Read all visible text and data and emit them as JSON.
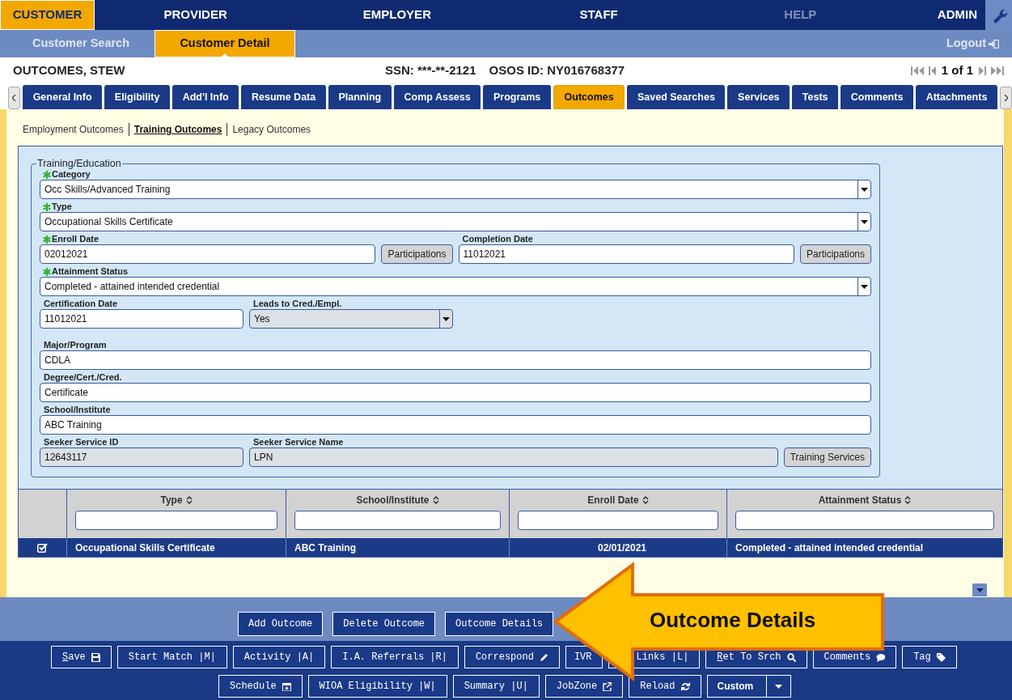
{
  "top_nav": [
    {
      "label": "CUSTOMER",
      "selected": true,
      "disabled": false
    },
    {
      "label": "PROVIDER",
      "selected": false,
      "disabled": false
    },
    {
      "label": "EMPLOYER",
      "selected": false,
      "disabled": false
    },
    {
      "label": "STAFF",
      "selected": false,
      "disabled": false
    },
    {
      "label": "HELP",
      "selected": false,
      "disabled": true
    },
    {
      "label": "ADMIN",
      "selected": false,
      "disabled": false
    }
  ],
  "sub_nav": [
    {
      "label": "Customer Search",
      "selected": false
    },
    {
      "label": "Customer Detail",
      "selected": true
    }
  ],
  "logout": "Logout",
  "record": {
    "name": "OUTCOMES, STEW",
    "ssn": "SSN: ***-**-2121",
    "osos_id": "OSOS ID: NY016768377",
    "pager": "1 of 1"
  },
  "tabs": [
    {
      "label": "General Info",
      "selected": false
    },
    {
      "label": "Eligibility",
      "selected": false
    },
    {
      "label": "Add'l Info",
      "selected": false
    },
    {
      "label": "Resume Data",
      "selected": false
    },
    {
      "label": "Planning",
      "selected": false
    },
    {
      "label": "Comp Assess",
      "selected": false
    },
    {
      "label": "Programs",
      "selected": false
    },
    {
      "label": "Outcomes",
      "selected": true
    },
    {
      "label": "Saved Searches",
      "selected": false
    },
    {
      "label": "Services",
      "selected": false
    },
    {
      "label": "Tests",
      "selected": false
    },
    {
      "label": "Comments",
      "selected": false
    },
    {
      "label": "Attachments",
      "selected": false
    }
  ],
  "subtabs": [
    {
      "label": "Employment Outcomes",
      "selected": false
    },
    {
      "label": "Training Outcomes",
      "selected": true
    },
    {
      "label": "Legacy Outcomes",
      "selected": false
    }
  ],
  "form": {
    "legend": "Training/Education",
    "rows": [
      [
        {
          "label": "Category",
          "required": true,
          "kind": "select",
          "value": "Occ Skills/Advanced Training"
        }
      ],
      [
        {
          "label": "Type",
          "required": true,
          "kind": "select",
          "value": "Occupational Skills Certificate"
        }
      ],
      [
        {
          "label": "Enroll Date",
          "required": true,
          "kind": "text",
          "value": "02012021",
          "button": "Participations"
        },
        {
          "label": "Completion Date",
          "required": false,
          "kind": "text",
          "value": "11012021",
          "button": "Participations"
        }
      ],
      [
        {
          "label": "Attainment Status",
          "required": true,
          "kind": "select",
          "value": "Completed - attained intended credential"
        }
      ],
      [
        {
          "label": "Certification Date",
          "required": false,
          "kind": "text",
          "value": "11012021"
        },
        {
          "label": "Leads to Cred./Empl.",
          "required": false,
          "kind": "locked-select",
          "value": "Yes"
        }
      ],
      [
        {
          "label": "Major/Program",
          "required": false,
          "kind": "text",
          "value": "CDLA"
        }
      ],
      [
        {
          "label": "Degree/Cert./Cred.",
          "required": false,
          "kind": "text",
          "value": "Certificate"
        }
      ],
      [
        {
          "label": "School/Institute",
          "required": false,
          "kind": "text",
          "value": "ABC Training"
        }
      ],
      [
        {
          "label": "Seeker Service ID",
          "required": false,
          "kind": "readonly",
          "value": "12643117"
        },
        {
          "label": "Seeker Service Name",
          "required": false,
          "kind": "readonly",
          "value": "LPN",
          "button": "Training Services"
        }
      ]
    ]
  },
  "grid": {
    "columns": [
      "Type",
      "School/Institute",
      "Enroll Date",
      "Attainment Status"
    ],
    "rows": [
      {
        "checked": true,
        "selected": true,
        "cells": [
          "Occupational Skills Certificate",
          "ABC Training",
          "02/01/2021",
          "Completed - attained intended credential"
        ]
      }
    ]
  },
  "actions": [
    "Add Outcome",
    "Delete Outcome",
    "Outcome Details"
  ],
  "toolbar": [
    [
      {
        "label": "Save",
        "kind": "save",
        "underline_first": true
      },
      {
        "label": "Start Match |M|",
        "kind": "plain",
        "underline_first": false
      },
      {
        "label": "Activity |A|",
        "kind": "plain",
        "underline_first": false
      },
      {
        "label": "I.A. Referrals |R|",
        "kind": "plain",
        "underline_first": false
      },
      {
        "label": "Correspond",
        "kind": "pencil",
        "underline_first": false
      },
      {
        "label": "IVR",
        "kind": "plain",
        "underline_first": false
      },
      {
        "label": "Links |L|",
        "kind": "plain",
        "underline_first": false
      },
      {
        "label": "Ret To Srch",
        "kind": "search",
        "underline_first": true
      },
      {
        "label": "Comments",
        "kind": "comment",
        "underline_first": false
      },
      {
        "label": "Tag",
        "kind": "tag",
        "underline_first": false
      }
    ],
    [
      {
        "label": "Schedule",
        "kind": "calendar",
        "underline_first": false
      },
      {
        "label": "WIOA Eligibility |W|",
        "kind": "plain",
        "underline_first": false
      },
      {
        "label": "Summary |U|",
        "kind": "plain",
        "underline_first": false
      },
      {
        "label": "JobZone",
        "kind": "external",
        "underline_first": false
      },
      {
        "label": "Reload",
        "kind": "reload",
        "underline_first": false
      },
      {
        "label": "Custom",
        "kind": "split",
        "underline_first": false
      }
    ]
  ],
  "callout": {
    "text": "Outcome Details"
  }
}
